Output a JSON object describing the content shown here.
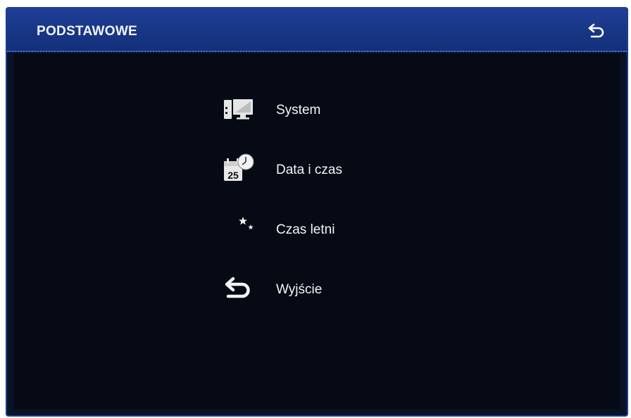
{
  "header": {
    "title": "PODSTAWOWE",
    "back_icon": "undo-arrow-icon"
  },
  "menu": {
    "items": [
      {
        "label": "System",
        "icon": "computer-monitor-icon"
      },
      {
        "label": "Data i czas",
        "icon": "calendar-clock-icon",
        "icon_text": "25"
      },
      {
        "label": "Czas letni",
        "icon": "moon-stars-icon"
      },
      {
        "label": "Wyjście",
        "icon": "undo-arrow-icon"
      }
    ]
  },
  "colors": {
    "titlebar": "#173583",
    "border": "#1b3f8e",
    "background": "#0a1226",
    "text": "#f4f4f4"
  }
}
